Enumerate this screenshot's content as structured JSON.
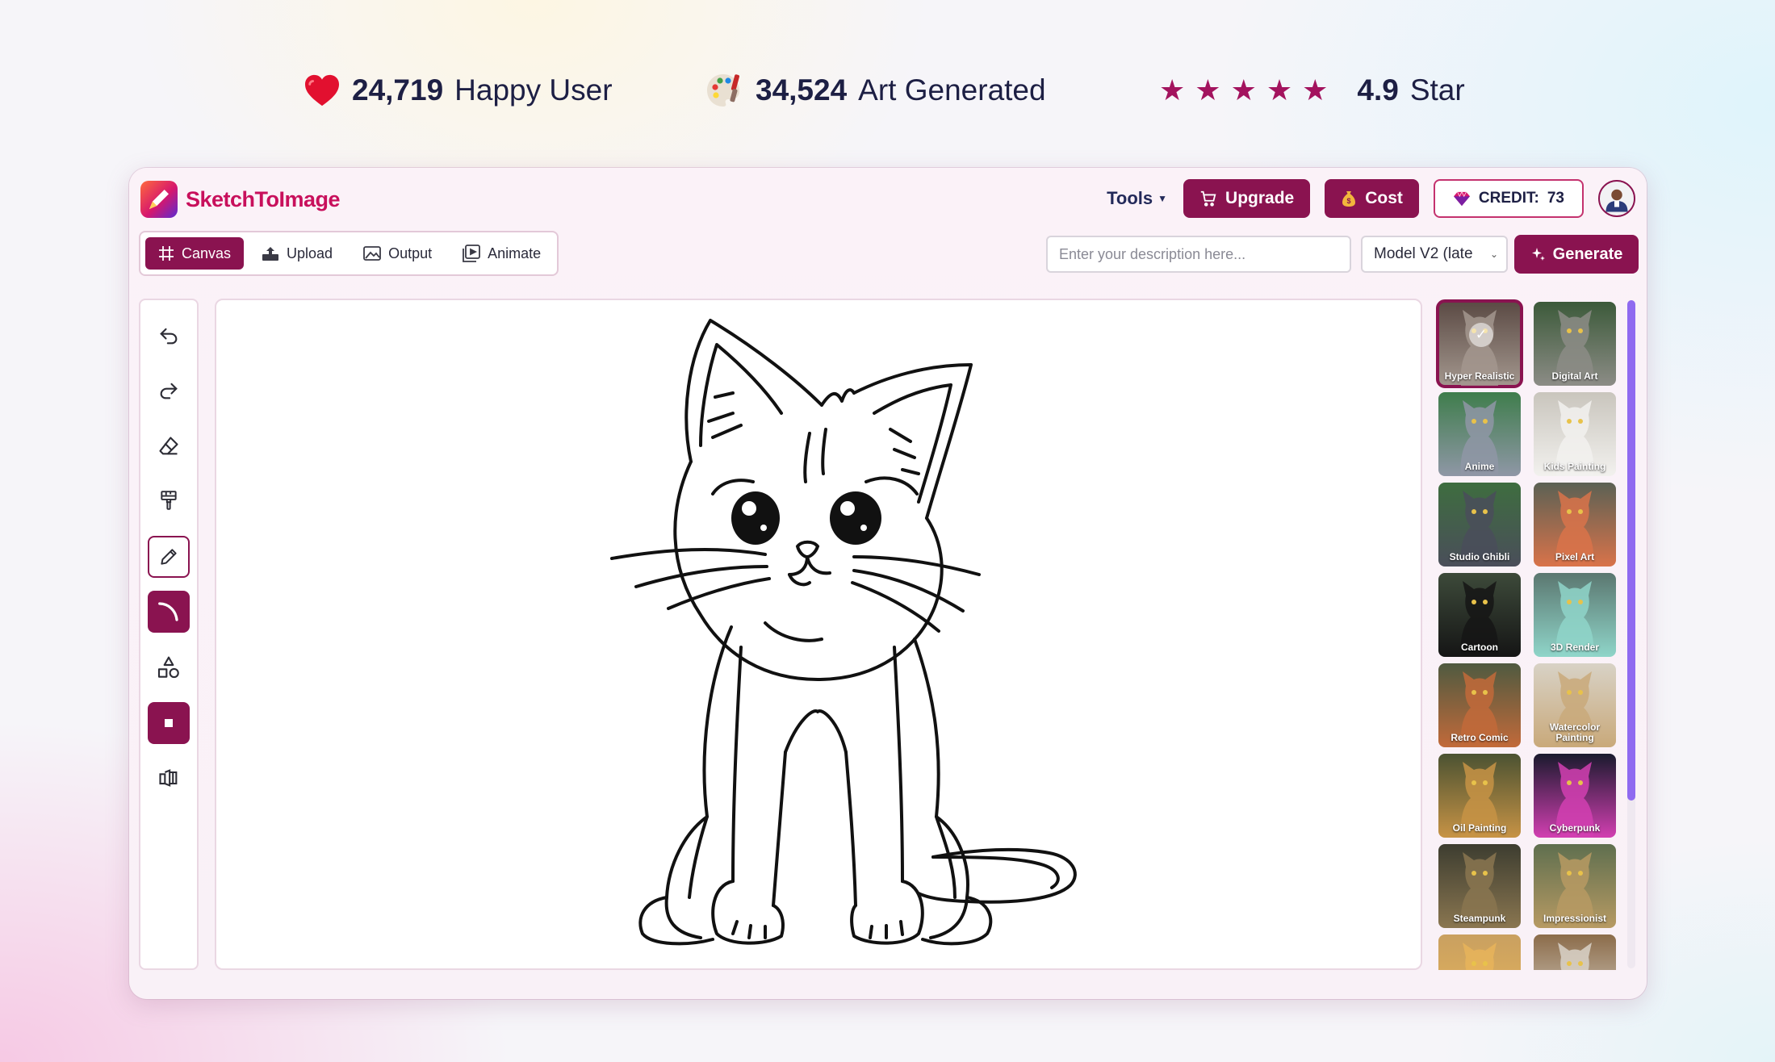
{
  "stats": {
    "users": {
      "value": "24,719",
      "label": "Happy User",
      "icon": "heart-icon"
    },
    "art": {
      "value": "34,524",
      "label": "Art Generated",
      "icon": "palette-icon"
    },
    "rating": {
      "value": "4.9",
      "label": "Star",
      "stars": 5
    }
  },
  "header": {
    "logo_text": "SketchToImage",
    "tools_label": "Tools",
    "upgrade_label": "Upgrade",
    "cost_label": "Cost",
    "credit_label": "CREDIT:",
    "credit_value": "73"
  },
  "tabs": [
    {
      "label": "Canvas",
      "icon": "grid-icon",
      "active": true
    },
    {
      "label": "Upload",
      "icon": "upload-icon",
      "active": false
    },
    {
      "label": "Output",
      "icon": "image-icon",
      "active": false
    },
    {
      "label": "Animate",
      "icon": "video-icon",
      "active": false
    }
  ],
  "prompt": {
    "placeholder": "Enter your description here...",
    "value": ""
  },
  "model": {
    "selected": "Model V2 (late"
  },
  "generate_label": "Generate",
  "tools": [
    {
      "name": "undo-icon",
      "state": "normal"
    },
    {
      "name": "redo-icon",
      "state": "normal"
    },
    {
      "name": "eraser-icon",
      "state": "normal"
    },
    {
      "name": "brush-icon",
      "state": "normal"
    },
    {
      "name": "pencil-icon",
      "state": "outlined"
    },
    {
      "name": "curve-icon",
      "state": "filled"
    },
    {
      "name": "shapes-icon",
      "state": "normal"
    },
    {
      "name": "stroke-size-icon",
      "state": "filled"
    },
    {
      "name": "layers-icon",
      "state": "normal"
    }
  ],
  "styles": [
    {
      "label": "Hyper Realistic",
      "selected": true,
      "colors": [
        "#5b4a44",
        "#a3978e"
      ]
    },
    {
      "label": "Digital Art",
      "selected": false,
      "colors": [
        "#3c5a3a",
        "#8c8c86"
      ]
    },
    {
      "label": "Anime",
      "selected": false,
      "colors": [
        "#3f7d4c",
        "#8f97a6"
      ]
    },
    {
      "label": "Kids Painting",
      "selected": false,
      "colors": [
        "#c9c5bd",
        "#f2f1ee"
      ]
    },
    {
      "label": "Studio Ghibli",
      "selected": false,
      "colors": [
        "#3e6d3f",
        "#4a4e5a"
      ]
    },
    {
      "label": "Pixel Art",
      "selected": false,
      "colors": [
        "#5b6154",
        "#d9734a"
      ]
    },
    {
      "label": "Cartoon",
      "selected": false,
      "colors": [
        "#3d4a3a",
        "#151515"
      ]
    },
    {
      "label": "3D Render",
      "selected": false,
      "colors": [
        "#5b7770",
        "#8fd5c9"
      ]
    },
    {
      "label": "Retro Comic",
      "selected": false,
      "colors": [
        "#4f5a40",
        "#c26a3a"
      ]
    },
    {
      "label": "Watercolor Painting",
      "selected": false,
      "colors": [
        "#d8d2c6",
        "#c9a97a"
      ]
    },
    {
      "label": "Oil Painting",
      "selected": false,
      "colors": [
        "#4b5232",
        "#c79345"
      ]
    },
    {
      "label": "Cyberpunk",
      "selected": false,
      "colors": [
        "#1a1a2e",
        "#d23fb1"
      ]
    },
    {
      "label": "Steampunk",
      "selected": false,
      "colors": [
        "#3d3d30",
        "#8a7650"
      ]
    },
    {
      "label": "Impressionist",
      "selected": false,
      "colors": [
        "#5f6f4f",
        "#b79a63"
      ]
    },
    {
      "label": "",
      "selected": false,
      "colors": [
        "#c9a060",
        "#e7b45a"
      ]
    },
    {
      "label": "",
      "selected": false,
      "colors": [
        "#8b6c4a",
        "#d9d2c8"
      ]
    }
  ]
}
